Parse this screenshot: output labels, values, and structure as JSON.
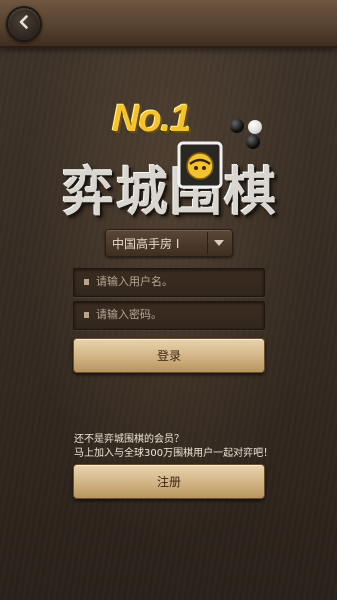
{
  "header": {
    "back_icon": "chevron-left-icon"
  },
  "logo": {
    "no1": "No.1",
    "title": "弈城围棋"
  },
  "room": {
    "selected": "中国高手房 Ⅰ"
  },
  "form": {
    "username_placeholder": "请输入用户名。",
    "password_placeholder": "请输入密码。",
    "login_label": "登录"
  },
  "signup": {
    "question": "还不是弈城围棋的会员？",
    "invite": "马上加入与全球300万围棋用户一起对弈吧！",
    "register_label": "注册"
  },
  "colors": {
    "accent_gold": "#f2c230",
    "button_tan": "#d4b789",
    "background": "#352b22"
  }
}
